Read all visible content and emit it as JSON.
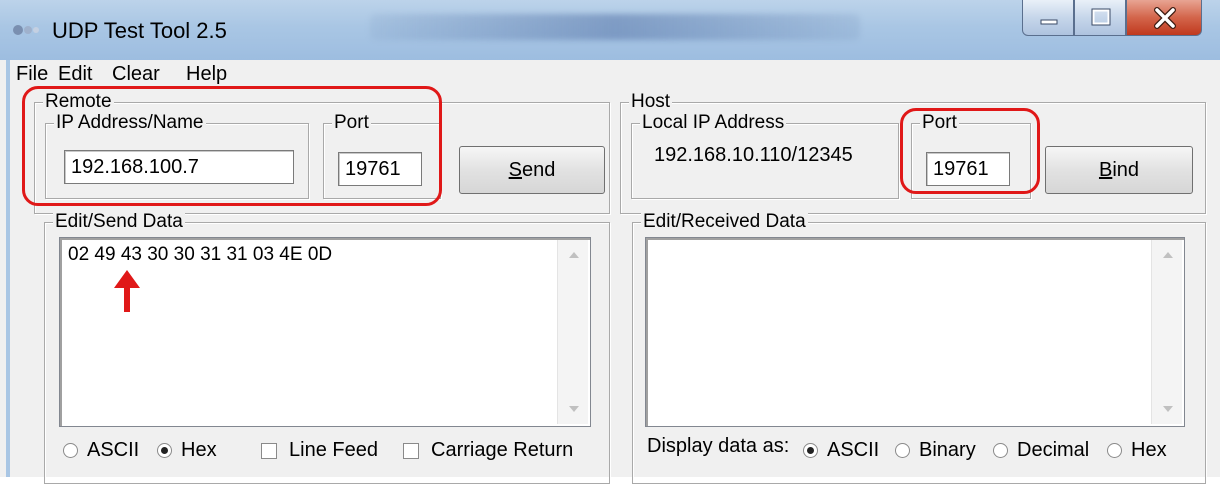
{
  "window": {
    "title": "UDP Test Tool 2.5"
  },
  "menu": [
    "File",
    "Edit",
    "Clear",
    "Help"
  ],
  "remote": {
    "group_label": "Remote",
    "ip_group_label": "IP Address/Name",
    "ip_value": "192.168.100.7",
    "port_group_label": "Port",
    "port_value": "19761",
    "send_label_prefix": "",
    "send_label_key": "S",
    "send_label_rest": "end"
  },
  "host": {
    "group_label": "Host",
    "local_ip_group_label": "Local IP Address",
    "local_ip_value": "192.168.10.110/12345",
    "port_group_label": "Port",
    "port_value": "19761",
    "bind_label_key": "B",
    "bind_label_rest": "ind"
  },
  "send_data": {
    "group_label": "Edit/Send Data",
    "text": "02 49 43 30 30 31 31 03 4E 0D",
    "options": [
      {
        "type": "radio",
        "label": "ASCII",
        "selected": false
      },
      {
        "type": "radio",
        "label": "Hex",
        "selected": true
      },
      {
        "type": "checkbox",
        "label": "Line Feed",
        "checked": false
      },
      {
        "type": "checkbox",
        "label": "Carriage Return",
        "checked": false
      }
    ]
  },
  "received_data": {
    "group_label": "Edit/Received Data",
    "text": "",
    "display_label": "Display data as:",
    "options": [
      {
        "label": "ASCII",
        "selected": true
      },
      {
        "label": "Binary",
        "selected": false
      },
      {
        "label": "Decimal",
        "selected": false
      },
      {
        "label": "Hex",
        "selected": false
      }
    ]
  },
  "colors": {
    "highlight": "#e01818",
    "titlebar": "#a9c6e4",
    "dialog": "#f0f0f0"
  }
}
